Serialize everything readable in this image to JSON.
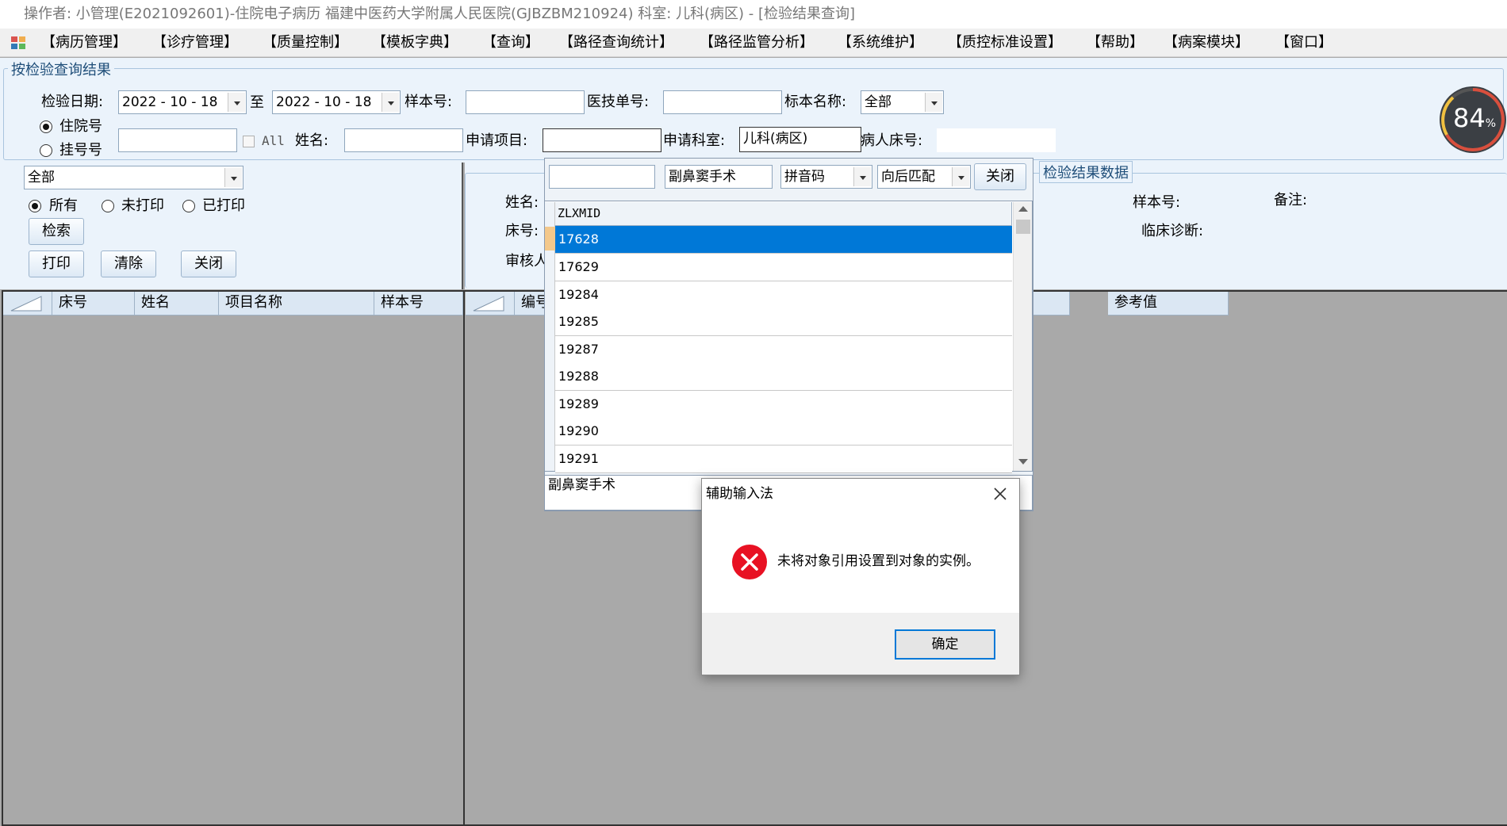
{
  "window": {
    "title": "操作者: 小管理(E2021092601)-住院电子病历  福建中医药大学附属人民医院(GJBZBM210924)  科室: 儿科(病区) - [检验结果查询]"
  },
  "menu": [
    "【病历管理】",
    "【诊疗管理】",
    "【质量控制】",
    "【模板字典】",
    "【查询】",
    "【路径查询统计】",
    "【路径监管分析】",
    "【系统维护】",
    "【质控标准设置】",
    "【帮助】",
    "【病案模块】",
    "【窗口】"
  ],
  "query": {
    "group_title": "按检验查询结果",
    "date_label": "检验日期:",
    "date_from": "2022 - 10 - 18",
    "date_to_label": "至",
    "date_to": "2022 - 10 - 18",
    "sample_no_label": "样本号:",
    "sample_no": "",
    "tech_no_label": "医技单号:",
    "tech_no": "",
    "specimen_label": "标本名称:",
    "specimen": "全部",
    "radio_inpatient": "住院号",
    "radio_registration": "挂号号",
    "patient_no": "",
    "all_label": "All",
    "name_label": "姓名:",
    "name": "",
    "apply_item_label": "申请项目:",
    "apply_item": "",
    "apply_dept_label": "申请科室:",
    "apply_dept": "儿科(病区)",
    "bed_label": "病人床号:",
    "bed": ""
  },
  "left": {
    "filter": "全部",
    "radio_all": "所有",
    "radio_unprinted": "未打印",
    "radio_printed": "已打印",
    "search_btn": "检索",
    "print_btn": "打印",
    "clear_btn": "清除",
    "close_btn": "关闭",
    "columns": [
      "床号",
      "姓名",
      "项目名称",
      "样本号"
    ]
  },
  "right": {
    "group_title": "检验结果数据",
    "name_label": "姓名:",
    "bed_label": "床号:",
    "reviewer_label": "审核人",
    "sample_label": "样本号:",
    "note_label": "备注:",
    "diagnosis_label": "临床诊断:",
    "columns": [
      "编号",
      "参考值"
    ]
  },
  "popup": {
    "search_value": "",
    "item_value": "副鼻窦手术",
    "mode": "拼音码",
    "match": "向后匹配",
    "close_btn": "关闭",
    "column": "ZLXMID",
    "rows": [
      "17628",
      "17629",
      "19284",
      "19285",
      "19287",
      "19288",
      "19289",
      "19290",
      "19291"
    ],
    "bottom_text": "副鼻窦手术"
  },
  "dialog": {
    "title": "辅助输入法",
    "message": "未将对象引用设置到对象的实例。",
    "ok": "确定"
  },
  "gauge": {
    "value": "84",
    "unit": "%"
  }
}
